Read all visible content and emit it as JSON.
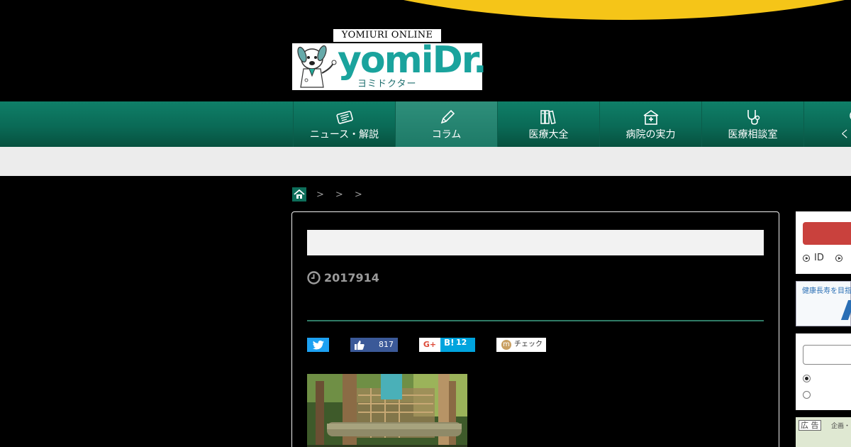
{
  "logo": {
    "top_text": "YOMIURI ONLINE",
    "wordmark": "yomiDr.",
    "kana": "ヨミドクター"
  },
  "nav": {
    "items": [
      {
        "label": "ニュース・解説",
        "icon": "newspaper-icon",
        "active": false
      },
      {
        "label": "コラム",
        "icon": "pencil-icon",
        "active": true
      },
      {
        "label": "医療大全",
        "icon": "books-icon",
        "active": false
      },
      {
        "label": "病院の実力",
        "icon": "hospital-icon",
        "active": false
      },
      {
        "label": "医療相談室",
        "icon": "stethoscope-icon",
        "active": false
      },
      {
        "label": "くらし",
        "icon": "circle-icon",
        "active": false
      }
    ]
  },
  "breadcrumb": {
    "home_icon": "home-icon",
    "separators": [
      ">",
      ">",
      ">"
    ]
  },
  "article": {
    "date": "2017914",
    "clock_icon": "clock-icon"
  },
  "share": {
    "twitter_icon": "twitter-icon",
    "facebook_count": "817",
    "google_plus_label": "G+",
    "hatena_label": "B!",
    "hatena_count": "12",
    "mixi_icon_letter": "m",
    "mixi_label": "チェック"
  },
  "sidebar": {
    "login_id_label": "ID",
    "banner_text": "健康長寿を目指",
    "ad_label": "広 告",
    "ad_sub": "企画・"
  },
  "colors": {
    "nav_green": "#0a6a56",
    "divider_green": "#2f7b66",
    "top_arc_yellow": "#f5c518",
    "twitter_blue": "#1da1f2",
    "facebook_blue": "#3b5998",
    "hatena_blue": "#00a4de",
    "login_red": "#c9413d"
  }
}
